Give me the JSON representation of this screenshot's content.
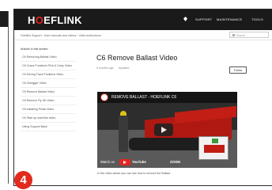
{
  "header": {
    "logo": {
      "part1": "H",
      "part2": "O",
      "part3": "EFLINK"
    },
    "nav": {
      "support": "SUPPORT",
      "maintenance": "MAINTENANCE",
      "tools": "TOOLS"
    }
  },
  "breadcrumb": "Hoeflink Support › User manuals and videos › Video instructions",
  "search": {
    "placeholder": "Search"
  },
  "sidebar": {
    "heading": "Articles in this section",
    "items": [
      "C6 Removing Ballast Video",
      "C6 Crane Functions Pick & Carry Video",
      "C6 Driving Track Positions Video",
      "C6 Outrigger Video",
      "C6 Remove Ballast Video",
      "C6 Remove Fly Jib Video",
      "C6 Installing Pedal Video",
      "C6 Start up machine video",
      "Using Support Base"
    ]
  },
  "article": {
    "title": "C6 Remove Ballast Video",
    "meta_time": "5 months ago",
    "meta_updated": "Updated",
    "follow": "Follow",
    "caption": "In the video above you can see how to remove the Ballast."
  },
  "video": {
    "title": "REMOVE BALLAST - HOEFLINK C6",
    "watch_on": "Watch on",
    "youtube": "YouTube",
    "overlay": "ZOOM"
  },
  "badge": "4",
  "colors": {
    "brand_red": "#e5251f",
    "header_bg": "#1a1a1a"
  }
}
